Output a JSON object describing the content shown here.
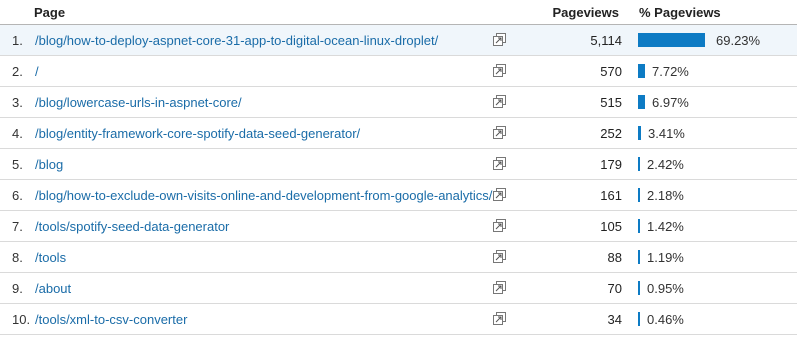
{
  "header": {
    "page_label": "Page",
    "pageviews_label": "Pageviews",
    "pct_label": "% Pageviews"
  },
  "colors": {
    "bar": "#0d7bc4",
    "link": "#1a6ca8"
  },
  "rows": [
    {
      "index": "1.",
      "page": "/blog/how-to-deploy-aspnet-core-31-app-to-digital-ocean-linux-droplet/",
      "pageviews": "5,114",
      "pct": "69.23%",
      "share": 0.6923
    },
    {
      "index": "2.",
      "page": "/",
      "pageviews": "570",
      "pct": "7.72%",
      "share": 0.0772
    },
    {
      "index": "3.",
      "page": "/blog/lowercase-urls-in-aspnet-core/",
      "pageviews": "515",
      "pct": "6.97%",
      "share": 0.0697
    },
    {
      "index": "4.",
      "page": "/blog/entity-framework-core-spotify-data-seed-generator/",
      "pageviews": "252",
      "pct": "3.41%",
      "share": 0.0341
    },
    {
      "index": "5.",
      "page": "/blog",
      "pageviews": "179",
      "pct": "2.42%",
      "share": 0.0242
    },
    {
      "index": "6.",
      "page": "/blog/how-to-exclude-own-visits-online-and-development-from-google-analytics/",
      "pageviews": "161",
      "pct": "2.18%",
      "share": 0.0218
    },
    {
      "index": "7.",
      "page": "/tools/spotify-seed-data-generator",
      "pageviews": "105",
      "pct": "1.42%",
      "share": 0.0142
    },
    {
      "index": "8.",
      "page": "/tools",
      "pageviews": "88",
      "pct": "1.19%",
      "share": 0.0119
    },
    {
      "index": "9.",
      "page": "/about",
      "pageviews": "70",
      "pct": "0.95%",
      "share": 0.0095
    },
    {
      "index": "10.",
      "page": "/tools/xml-to-csv-converter",
      "pageviews": "34",
      "pct": "0.46%",
      "share": 0.0046
    }
  ]
}
